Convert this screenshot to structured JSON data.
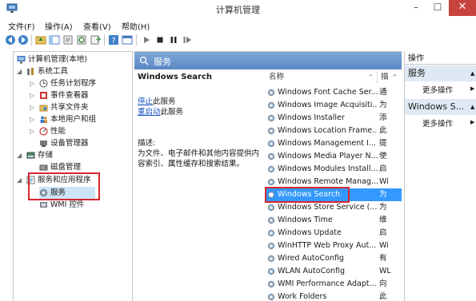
{
  "window": {
    "title": "计算机管理",
    "min": "–",
    "max": "☐",
    "close": "✕"
  },
  "menu": [
    "文件(F)",
    "操作(A)",
    "查看(V)",
    "帮助(H)"
  ],
  "tree": {
    "root": "计算机管理(本地)",
    "system_tools": "系统工具",
    "task_scheduler": "任务计划程序",
    "event_viewer": "事件查看器",
    "shared_folders": "共享文件夹",
    "local_users": "本地用户和组",
    "performance": "性能",
    "device_manager": "设备管理器",
    "storage": "存储",
    "disk_mgmt": "磁盘管理",
    "services_apps": "服务和应用程序",
    "services": "服务",
    "wmi": "WMI 控件"
  },
  "main": {
    "header": "服务",
    "detail_title": "Windows Search",
    "stop_link": "停止",
    "stop_text": "此服务",
    "restart_link": "重启动",
    "restart_text": "此服务",
    "desc_label": "描述:",
    "desc_line1": "为文件、电子邮件和其他内容提供内",
    "desc_line2": "容索引、属性缓存和搜索结果。",
    "col_name": "名称",
    "col_desc": "描",
    "sort_arrow": "^",
    "services": [
      {
        "name": "Windows Font Cache Ser...",
        "desc": "通"
      },
      {
        "name": "Windows Image Acquisiti...",
        "desc": "为"
      },
      {
        "name": "Windows Installer",
        "desc": "添"
      },
      {
        "name": "Windows Location Frame...",
        "desc": "此"
      },
      {
        "name": "Windows Management I...",
        "desc": "提"
      },
      {
        "name": "Windows Media Player N...",
        "desc": "使"
      },
      {
        "name": "Windows Modules Install...",
        "desc": "启"
      },
      {
        "name": "Windows Remote Manag...",
        "desc": "Wi"
      },
      {
        "name": "Windows Search",
        "desc": "为"
      },
      {
        "name": "Windows Store Service (...",
        "desc": "为"
      },
      {
        "name": "Windows Time",
        "desc": "维"
      },
      {
        "name": "Windows Update",
        "desc": "启"
      },
      {
        "name": "WinHTTP Web Proxy Aut...",
        "desc": "Wi"
      },
      {
        "name": "Wired AutoConfig",
        "desc": "有"
      },
      {
        "name": "WLAN AutoConfig",
        "desc": "WL"
      },
      {
        "name": "WMI Performance Adapt...",
        "desc": "向"
      },
      {
        "name": "Work Folders",
        "desc": "此"
      }
    ],
    "selected_index": 8
  },
  "actions": {
    "head": "操作",
    "section1": "服务",
    "more1": "更多操作",
    "section2": "Windows S...",
    "more2": "更多操作"
  },
  "colors": {
    "highlight": "#3399ff",
    "header_blue": "#5b88c4",
    "red_annotation": "#d7262e",
    "close_red": "#c7433e"
  }
}
